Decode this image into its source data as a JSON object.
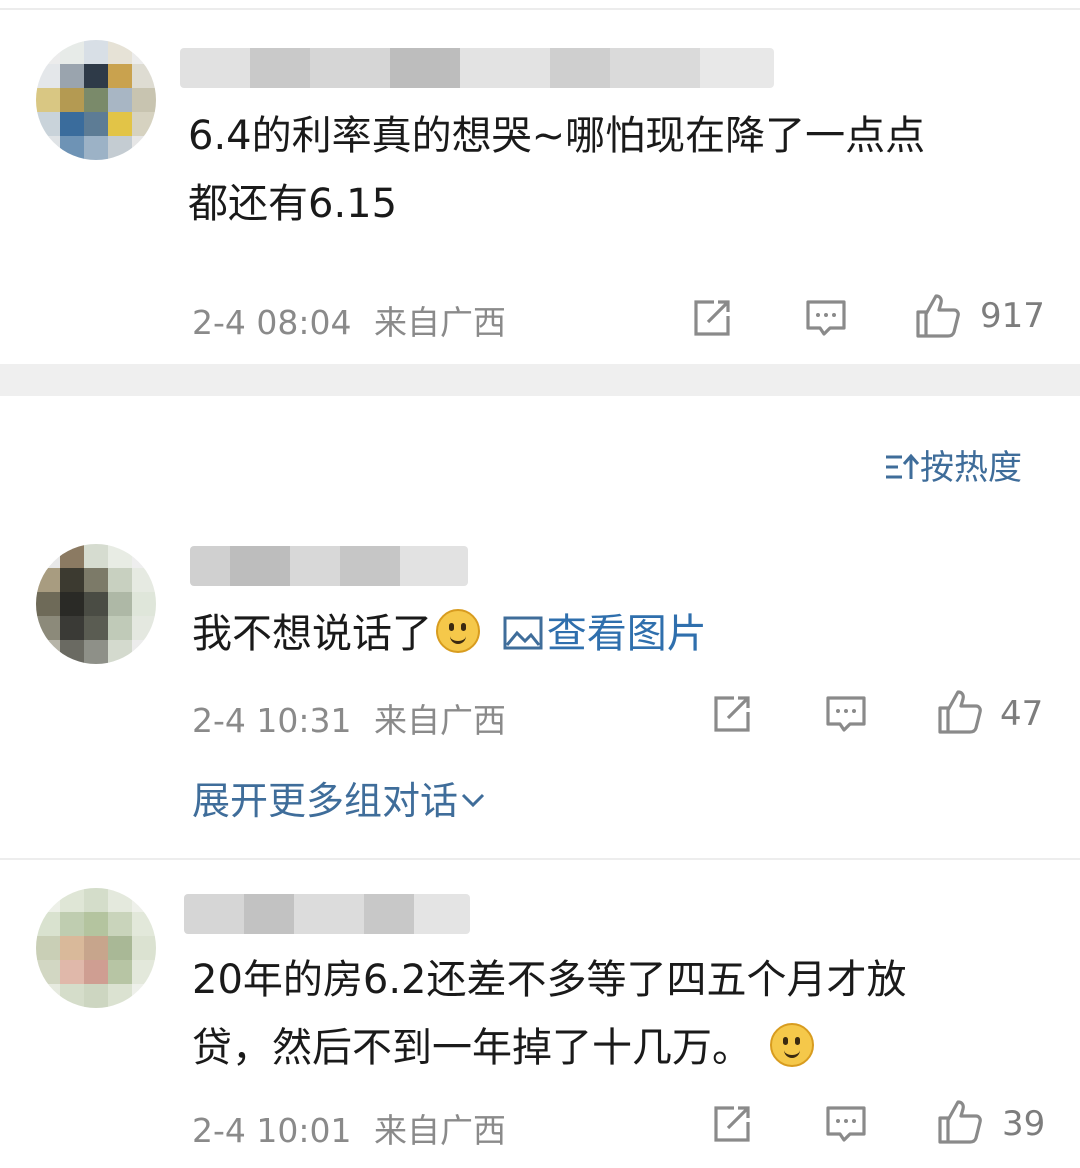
{
  "sort": {
    "label": "按热度"
  },
  "expand": {
    "label": "展开更多组对话"
  },
  "comments": [
    {
      "text_line1": "6.4的利率真的想哭~哪怕现在降了一点点",
      "text_line2": "都还有6.15",
      "time": "2-4 08:04",
      "location": "来自广西",
      "likes": "917"
    },
    {
      "text": "我不想说话了",
      "image_link": "查看图片",
      "time": "2-4 10:31",
      "location": "来自广西",
      "likes": "47"
    },
    {
      "text_line1": "20年的房6.2还差不多等了四五个月才放",
      "text_line2": "贷，然后不到一年掉了十几万。",
      "time": "2-4 10:01",
      "location": "来自广西",
      "likes": "39"
    }
  ],
  "icons": {
    "repost": "repost-icon",
    "comment": "comment-icon",
    "like": "thumbs-up-icon",
    "image": "image-icon",
    "sort": "sort-icon",
    "chevron": "chevron-down-icon"
  },
  "colors": {
    "link": "#3f6d9a",
    "meta": "#8a8a8a",
    "band": "#efefef"
  }
}
